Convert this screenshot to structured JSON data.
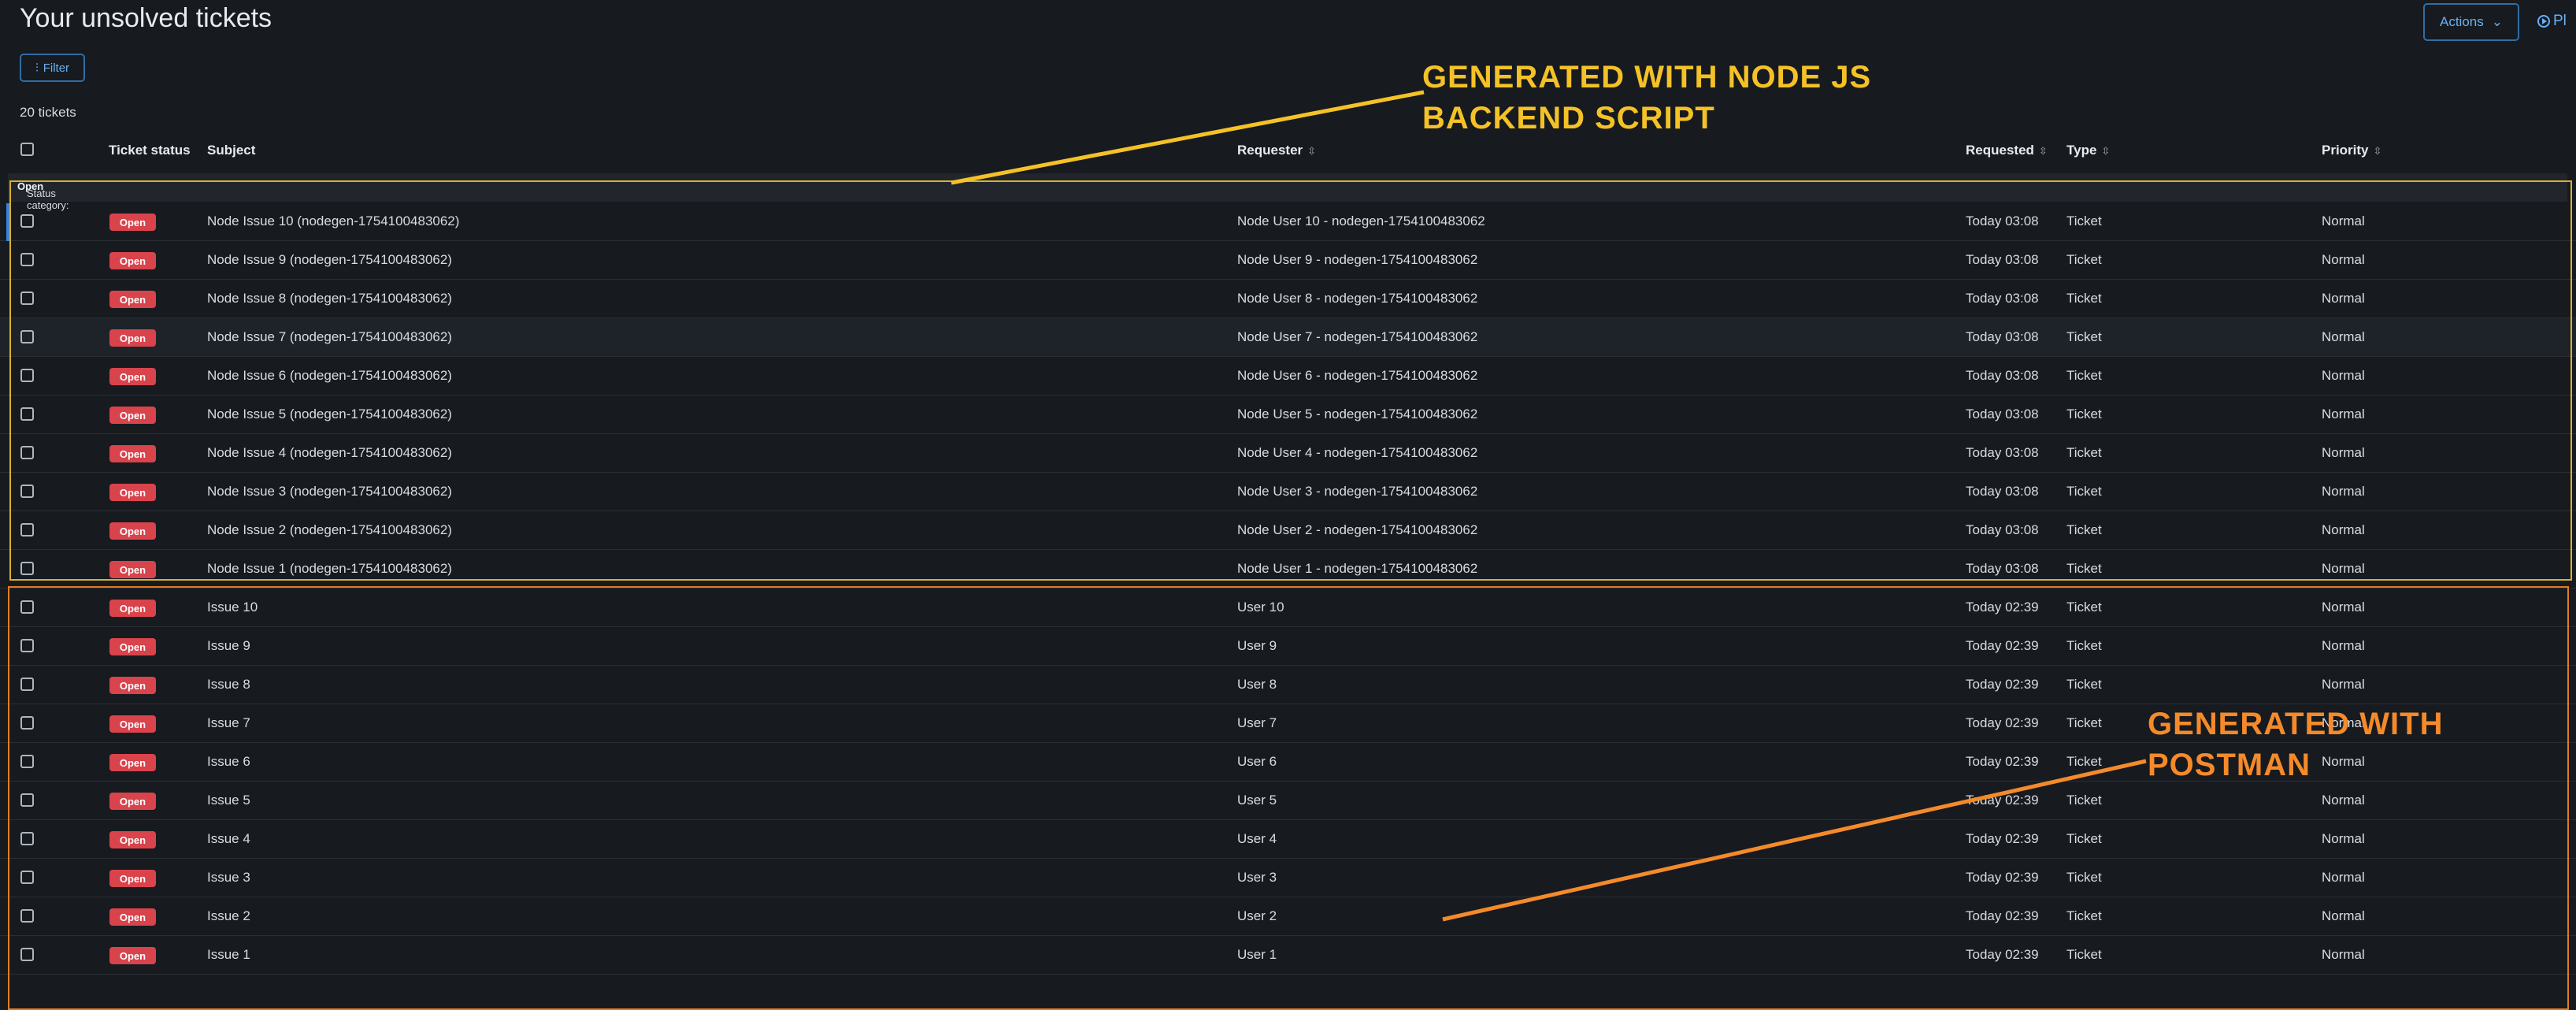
{
  "page": {
    "title": "Your unsolved tickets",
    "filter_label": "Filter",
    "ticket_count": "20 tickets",
    "actions_label": "Actions",
    "play_label": "Pl"
  },
  "columns": {
    "status": "Ticket status",
    "subject": "Subject",
    "requester": "Requester",
    "requested": "Requested",
    "type": "Type",
    "priority": "Priority"
  },
  "category": {
    "label": "Status category:",
    "value": "Open"
  },
  "rows": [
    {
      "status": "Open",
      "subject": "Node Issue 10 (nodegen-1754100483062)",
      "requester": "Node User 10 - nodegen-1754100483062",
      "requested": "Today 03:08",
      "type": "Ticket",
      "priority": "Normal"
    },
    {
      "status": "Open",
      "subject": "Node Issue 9 (nodegen-1754100483062)",
      "requester": "Node User 9 - nodegen-1754100483062",
      "requested": "Today 03:08",
      "type": "Ticket",
      "priority": "Normal"
    },
    {
      "status": "Open",
      "subject": "Node Issue 8 (nodegen-1754100483062)",
      "requester": "Node User 8 - nodegen-1754100483062",
      "requested": "Today 03:08",
      "type": "Ticket",
      "priority": "Normal"
    },
    {
      "status": "Open",
      "subject": "Node Issue 7 (nodegen-1754100483062)",
      "requester": "Node User 7 - nodegen-1754100483062",
      "requested": "Today 03:08",
      "type": "Ticket",
      "priority": "Normal"
    },
    {
      "status": "Open",
      "subject": "Node Issue 6 (nodegen-1754100483062)",
      "requester": "Node User 6 - nodegen-1754100483062",
      "requested": "Today 03:08",
      "type": "Ticket",
      "priority": "Normal"
    },
    {
      "status": "Open",
      "subject": "Node Issue 5 (nodegen-1754100483062)",
      "requester": "Node User 5 - nodegen-1754100483062",
      "requested": "Today 03:08",
      "type": "Ticket",
      "priority": "Normal"
    },
    {
      "status": "Open",
      "subject": "Node Issue 4 (nodegen-1754100483062)",
      "requester": "Node User 4 - nodegen-1754100483062",
      "requested": "Today 03:08",
      "type": "Ticket",
      "priority": "Normal"
    },
    {
      "status": "Open",
      "subject": "Node Issue 3 (nodegen-1754100483062)",
      "requester": "Node User 3 - nodegen-1754100483062",
      "requested": "Today 03:08",
      "type": "Ticket",
      "priority": "Normal"
    },
    {
      "status": "Open",
      "subject": "Node Issue 2 (nodegen-1754100483062)",
      "requester": "Node User 2 - nodegen-1754100483062",
      "requested": "Today 03:08",
      "type": "Ticket",
      "priority": "Normal"
    },
    {
      "status": "Open",
      "subject": "Node Issue 1 (nodegen-1754100483062)",
      "requester": "Node User 1 - nodegen-1754100483062",
      "requested": "Today 03:08",
      "type": "Ticket",
      "priority": "Normal"
    },
    {
      "status": "Open",
      "subject": "Issue 10",
      "requester": "User 10",
      "requested": "Today 02:39",
      "type": "Ticket",
      "priority": "Normal"
    },
    {
      "status": "Open",
      "subject": "Issue 9",
      "requester": "User 9",
      "requested": "Today 02:39",
      "type": "Ticket",
      "priority": "Normal"
    },
    {
      "status": "Open",
      "subject": "Issue 8",
      "requester": "User 8",
      "requested": "Today 02:39",
      "type": "Ticket",
      "priority": "Normal"
    },
    {
      "status": "Open",
      "subject": "Issue 7",
      "requester": "User 7",
      "requested": "Today 02:39",
      "type": "Ticket",
      "priority": "Normal"
    },
    {
      "status": "Open",
      "subject": "Issue 6",
      "requester": "User 6",
      "requested": "Today 02:39",
      "type": "Ticket",
      "priority": "Normal"
    },
    {
      "status": "Open",
      "subject": "Issue 5",
      "requester": "User 5",
      "requested": "Today 02:39",
      "type": "Ticket",
      "priority": "Normal"
    },
    {
      "status": "Open",
      "subject": "Issue 4",
      "requester": "User 4",
      "requested": "Today 02:39",
      "type": "Ticket",
      "priority": "Normal"
    },
    {
      "status": "Open",
      "subject": "Issue 3",
      "requester": "User 3",
      "requested": "Today 02:39",
      "type": "Ticket",
      "priority": "Normal"
    },
    {
      "status": "Open",
      "subject": "Issue 2",
      "requester": "User 2",
      "requested": "Today 02:39",
      "type": "Ticket",
      "priority": "Normal"
    },
    {
      "status": "Open",
      "subject": "Issue 1",
      "requester": "User 1",
      "requested": "Today 02:39",
      "type": "Ticket",
      "priority": "Normal"
    }
  ],
  "annotations": {
    "node_line1": "GENERATED WITH NODE JS",
    "node_line2": "BACKEND SCRIPT",
    "postman_line1": "GENERATED WITH",
    "postman_line2": "POSTMAN"
  },
  "colors": {
    "accent": "#3b82d6",
    "open_badge": "#d9434c",
    "annotation_yellow": "#f4c227",
    "annotation_orange": "#f58a2a"
  }
}
